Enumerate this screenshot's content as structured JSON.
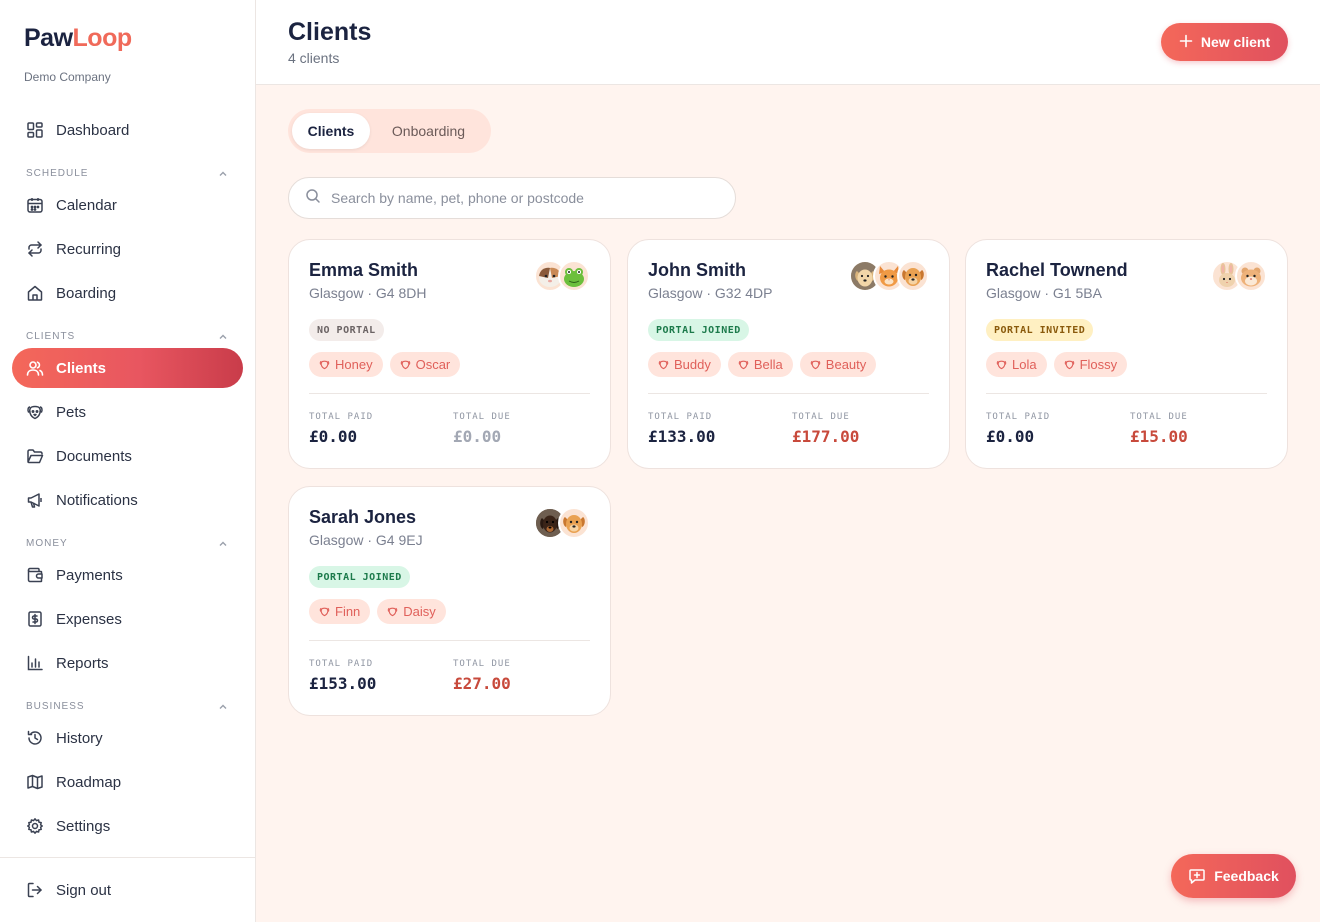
{
  "brand": {
    "name_part1": "Paw",
    "name_part2": "Loop",
    "company": "Demo Company"
  },
  "sidebar": {
    "dashboard": "Dashboard",
    "sections": {
      "schedule": "SCHEDULE",
      "clients": "CLIENTS",
      "money": "MONEY",
      "business": "BUSINESS"
    },
    "items": {
      "calendar": "Calendar",
      "recurring": "Recurring",
      "boarding": "Boarding",
      "clients": "Clients",
      "pets": "Pets",
      "documents": "Documents",
      "notifications": "Notifications",
      "payments": "Payments",
      "expenses": "Expenses",
      "reports": "Reports",
      "history": "History",
      "roadmap": "Roadmap",
      "settings": "Settings"
    },
    "sign_out": "Sign out"
  },
  "header": {
    "title": "Clients",
    "subtitle": "4 clients",
    "new_client": "New client"
  },
  "tabs": {
    "clients": "Clients",
    "onboarding": "Onboarding"
  },
  "search": {
    "placeholder": "Search by name, pet, phone or postcode"
  },
  "labels": {
    "total_paid": "TOTAL PAID",
    "total_due": "TOTAL DUE"
  },
  "clients": [
    {
      "name": "Emma Smith",
      "location": "Glasgow · G4 8DH",
      "badge": "NO PORTAL",
      "pets": [
        "Honey",
        "Oscar"
      ],
      "total_paid": "£0.00",
      "total_due": "£0.00"
    },
    {
      "name": "John Smith",
      "location": "Glasgow · G32 4DP",
      "badge": "PORTAL JOINED",
      "pets": [
        "Buddy",
        "Bella",
        "Beauty"
      ],
      "total_paid": "£133.00",
      "total_due": "£177.00"
    },
    {
      "name": "Rachel Townend",
      "location": "Glasgow · G1 5BA",
      "badge": "PORTAL INVITED",
      "pets": [
        "Lola",
        "Flossy"
      ],
      "total_paid": "£0.00",
      "total_due": "£15.00"
    },
    {
      "name": "Sarah Jones",
      "location": "Glasgow · G4 9EJ",
      "badge": "PORTAL JOINED",
      "pets": [
        "Finn",
        "Daisy"
      ],
      "total_paid": "£153.00",
      "total_due": "£27.00"
    }
  ],
  "feedback": "Feedback",
  "colors": {
    "accent": "#f06a5a",
    "accent_dark": "#c93c4a",
    "navy": "#1b2340",
    "page_bg": "#fff4ef"
  }
}
